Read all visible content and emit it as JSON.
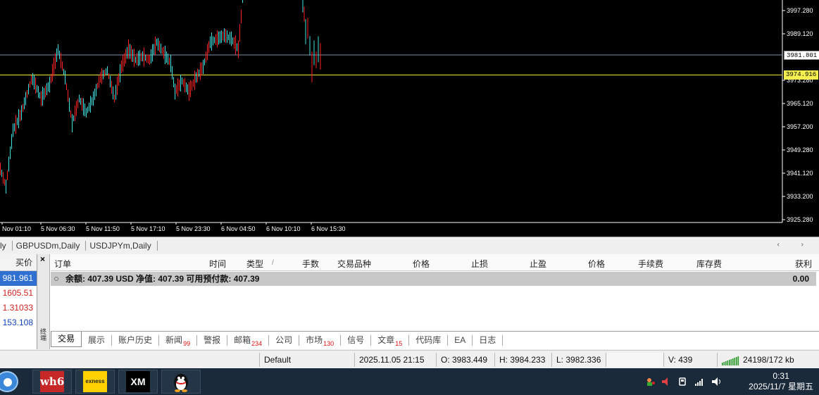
{
  "chart": {
    "price_levels": [
      "3997.280",
      "3989.120",
      "3973.280",
      "3965.120",
      "3957.200",
      "3949.280",
      "3941.120",
      "3933.200",
      "3925.280"
    ],
    "bid_tag": "3981.801",
    "ask_tag": "3974.916",
    "time_labels": [
      "Nov 01:10",
      "5 Nov 06:30",
      "5 Nov 11:50",
      "5 Nov 17:10",
      "5 Nov 23:30",
      "6 Nov 04:50",
      "6 Nov 10:10",
      "6 Nov 15:30"
    ],
    "colors": {
      "background": "#000000",
      "up": "#ff2020",
      "down": "#40e0e0",
      "bid_line": "#8090b0",
      "ask_line": "#e8e830"
    }
  },
  "chart_tabs": [
    "ly",
    "GBPUSDm,Daily",
    "USDJPYm,Daily"
  ],
  "chart_tab_nav": "‹ ›",
  "market_watch": {
    "header": "买价",
    "rows": [
      {
        "value": "981.961",
        "color": "#ffffff",
        "bg": "#3070d0"
      },
      {
        "value": "1605.51",
        "color": "#d02020"
      },
      {
        "value": "1.31033",
        "color": "#d02020"
      },
      {
        "value": "153.108",
        "color": "#1040c0"
      }
    ]
  },
  "terminal": {
    "close_glyph": "×",
    "side_label": "终端",
    "columns": [
      "订单",
      "时间",
      "类型",
      "手数",
      "交易品种",
      "价格",
      "止损",
      "止盈",
      "价格",
      "手续费",
      "库存费",
      "获利"
    ],
    "sort_glyph": "/",
    "balance_text": "余额: 407.39 USD  净值: 407.39  可用预付款: 407.39",
    "profit": "0.00",
    "tabs": [
      {
        "label": "交易",
        "badge": ""
      },
      {
        "label": "展示",
        "badge": ""
      },
      {
        "label": "账户历史",
        "badge": ""
      },
      {
        "label": "新闻",
        "badge": "99"
      },
      {
        "label": "警报",
        "badge": ""
      },
      {
        "label": "邮箱",
        "badge": "234"
      },
      {
        "label": "公司",
        "badge": ""
      },
      {
        "label": "市场",
        "badge": "130"
      },
      {
        "label": "信号",
        "badge": ""
      },
      {
        "label": "文章",
        "badge": "15"
      },
      {
        "label": "代码库",
        "badge": ""
      },
      {
        "label": "EA",
        "badge": ""
      },
      {
        "label": "日志",
        "badge": ""
      }
    ]
  },
  "status": {
    "profile": "Default",
    "datetime": "2025.11.05 21:15",
    "open": "O: 3983.449",
    "high": "H: 3984.233",
    "low": "L: 3982.336",
    "volume": "V: 439",
    "traffic": "24198/172 kb"
  },
  "taskbar": {
    "apps": [
      {
        "name": "wh6",
        "label": "wh6"
      },
      {
        "name": "exness",
        "label": "exness"
      },
      {
        "name": "xm",
        "label": "XM"
      }
    ],
    "clock_time": "0:31",
    "clock_date": "2025/11/7 星期五"
  }
}
